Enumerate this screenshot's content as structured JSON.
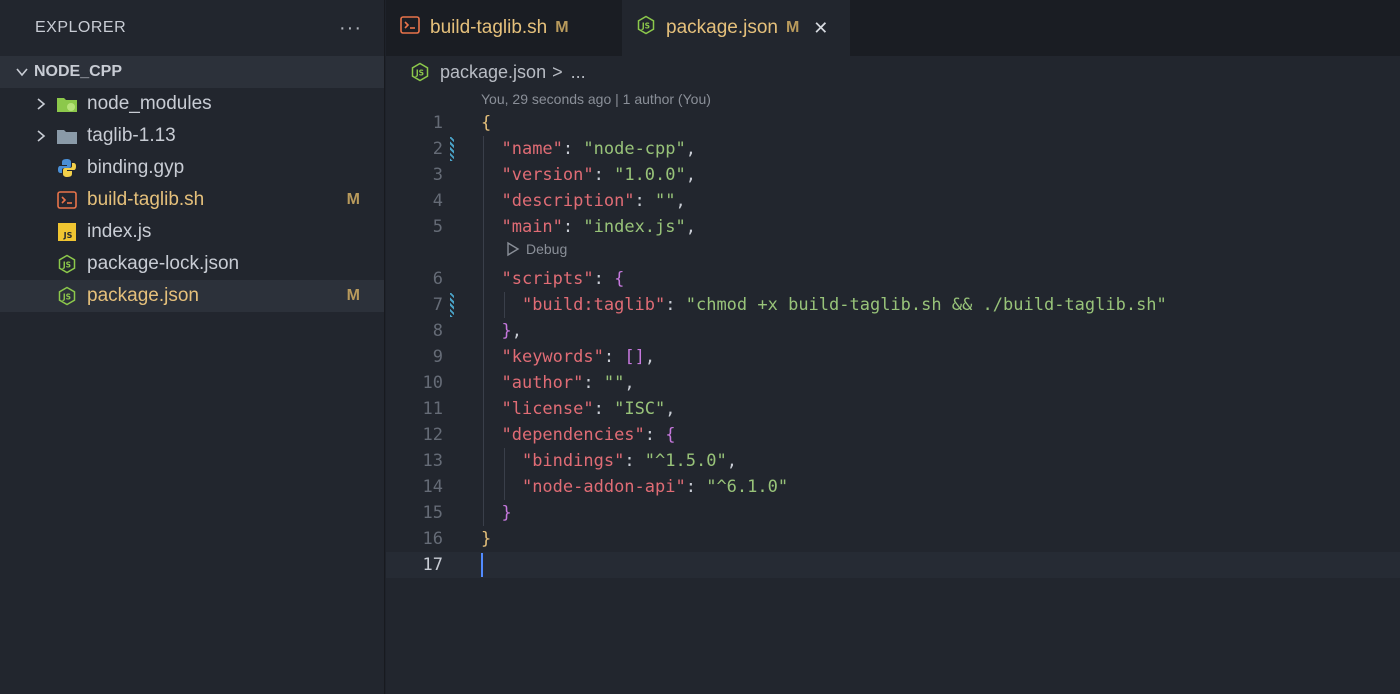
{
  "explorer": {
    "title": "EXPLORER",
    "more_label": "···",
    "workspace": "NODE_CPP",
    "items": [
      {
        "name": "node_modules",
        "kind": "folder",
        "icon": "node-folder-icon",
        "status": ""
      },
      {
        "name": "taglib-1.13",
        "kind": "folder",
        "icon": "folder-icon",
        "status": ""
      },
      {
        "name": "binding.gyp",
        "kind": "file",
        "icon": "python-icon",
        "status": ""
      },
      {
        "name": "build-taglib.sh",
        "kind": "file",
        "icon": "shell-icon",
        "status": "M"
      },
      {
        "name": "index.js",
        "kind": "file",
        "icon": "js-icon",
        "status": ""
      },
      {
        "name": "package-lock.json",
        "kind": "file",
        "icon": "nodejs-icon",
        "status": ""
      },
      {
        "name": "package.json",
        "kind": "file",
        "icon": "nodejs-icon",
        "status": "M"
      }
    ]
  },
  "tabs": [
    {
      "label": "build-taglib.sh",
      "status": "M",
      "icon": "shell-icon",
      "active": false
    },
    {
      "label": "package.json",
      "status": "M",
      "icon": "nodejs-icon",
      "active": true,
      "close": "✕"
    }
  ],
  "breadcrumb": {
    "file": "package.json",
    "separator": ">",
    "rest": "..."
  },
  "editor": {
    "blame": "You, 29 seconds ago | 1 author (You)",
    "codelens_debug": "Debug",
    "lines": [
      {
        "n": "1",
        "text": "{"
      },
      {
        "n": "2",
        "text": "  \"name\": \"node-cpp\","
      },
      {
        "n": "3",
        "text": "  \"version\": \"1.0.0\","
      },
      {
        "n": "4",
        "text": "  \"description\": \"\","
      },
      {
        "n": "5",
        "text": "  \"main\": \"index.js\","
      },
      {
        "n": "6",
        "text": "  \"scripts\": {"
      },
      {
        "n": "7",
        "text": "    \"build:taglib\": \"chmod +x build-taglib.sh && ./build-taglib.sh\""
      },
      {
        "n": "8",
        "text": "  },"
      },
      {
        "n": "9",
        "text": "  \"keywords\": [],"
      },
      {
        "n": "10",
        "text": "  \"author\": \"\","
      },
      {
        "n": "11",
        "text": "  \"license\": \"ISC\","
      },
      {
        "n": "12",
        "text": "  \"dependencies\": {"
      },
      {
        "n": "13",
        "text": "    \"bindings\": \"^1.5.0\","
      },
      {
        "n": "14",
        "text": "    \"node-addon-api\": \"^6.1.0\""
      },
      {
        "n": "15",
        "text": "  }"
      },
      {
        "n": "16",
        "text": "}"
      },
      {
        "n": "17",
        "text": ""
      }
    ],
    "modified_lines": [
      2,
      7
    ],
    "current_line": 17
  },
  "colors": {
    "background": "#22262e",
    "modified": "#e5c07b",
    "json_key": "#e06c75",
    "json_string": "#98c379",
    "cursor": "#528bff"
  }
}
